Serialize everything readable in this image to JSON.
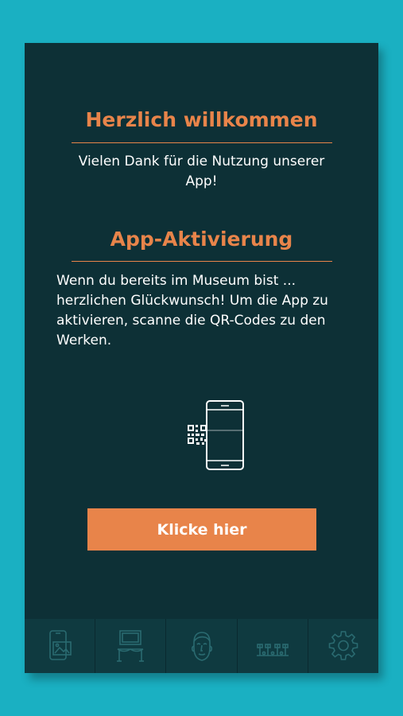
{
  "welcome": {
    "title": "Herzlich willkommen",
    "text_line1": "Vielen Dank für die Nutzung unserer",
    "text_line2": "App!"
  },
  "activation": {
    "title": "App-Aktivierung",
    "lines": [
      "Wenn du bereits im Museum bist ...",
      "herzlichen Glückwunsch! Um die App zu",
      "aktivieren, scanne die QR-Codes zu den",
      "Werken."
    ]
  },
  "cta": {
    "label": "Klicke hier"
  },
  "illustration": {
    "icon": "phone-qr-scan-icon"
  },
  "tabbar": {
    "tabs": [
      {
        "icon": "phone-gallery-icon"
      },
      {
        "icon": "museum-exhibit-icon"
      },
      {
        "icon": "face-icon"
      },
      {
        "icon": "signposts-icon"
      },
      {
        "icon": "gear-icon"
      }
    ]
  },
  "colors": {
    "page_background": "#1ab0c2",
    "card_background": "#0d3036",
    "accent": "#e8844a",
    "text": "#ffffff",
    "tabbar_background": "#0f3a40",
    "tab_icon": "#2a6a70"
  }
}
